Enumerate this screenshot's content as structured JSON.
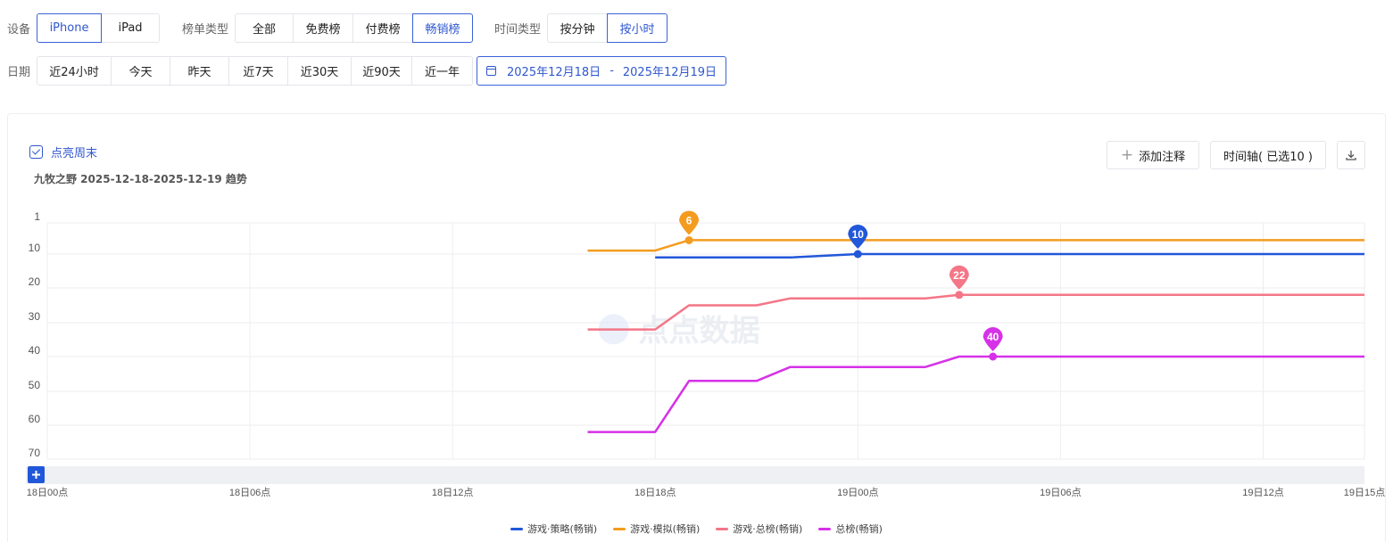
{
  "filters": {
    "device_label": "设备",
    "device_options": [
      "iPhone",
      "iPad"
    ],
    "device_selected": 0,
    "rank_type_label": "榜单类型",
    "rank_type_options": [
      "全部",
      "免费榜",
      "付费榜",
      "畅销榜"
    ],
    "rank_type_selected": 3,
    "time_type_label": "时间类型",
    "time_type_options": [
      "按分钟",
      "按小时"
    ],
    "time_type_selected": 1,
    "date_label": "日期",
    "date_options": [
      "近24小时",
      "今天",
      "昨天",
      "近7天",
      "近30天",
      "近90天",
      "近一年"
    ],
    "date_start": "2025年12月18日",
    "date_sep": "-",
    "date_end": "2025年12月19日"
  },
  "panel": {
    "weekend_label": "点亮周末",
    "weekend_checked": true,
    "subtitle": "九牧之野 2025-12-18-2025-12-19 趋势",
    "add_note_label": "添加注释",
    "timeline_label": "时间轴( 已选10 )",
    "download_icon": "download-icon",
    "zoom_icon": "plus-icon",
    "watermark": "点点数据"
  },
  "chart_data": {
    "type": "line",
    "title": "九牧之野 2025-12-18-2025-12-19 趋势",
    "y_inverted": true,
    "y_ticks": [
      1,
      10,
      20,
      30,
      40,
      50,
      60,
      70
    ],
    "ylim": [
      1,
      70
    ],
    "x_ticks": [
      "18日00点",
      "18日06点",
      "18日12点",
      "18日18点",
      "19日00点",
      "19日06点",
      "19日12点",
      "19日15点"
    ],
    "x_unit": "hours since 18日00点",
    "x_tick_hours": [
      0,
      6,
      12,
      18,
      24,
      30,
      36,
      39
    ],
    "grid": true,
    "legend_position": "bottom-center",
    "series": [
      {
        "name": "游戏·策略(畅销)",
        "color": "#2157d9",
        "points": [
          [
            18,
            11
          ],
          [
            20,
            11
          ],
          [
            22,
            11
          ],
          [
            24,
            10
          ],
          [
            26,
            10
          ],
          [
            28,
            10
          ],
          [
            39,
            10
          ]
        ],
        "marker": {
          "x": 24,
          "value": 10
        }
      },
      {
        "name": "游戏·模拟(畅销)",
        "color": "#f39c1f",
        "points": [
          [
            16,
            9
          ],
          [
            17,
            9
          ],
          [
            18,
            9
          ],
          [
            19,
            6
          ],
          [
            20,
            6
          ],
          [
            24,
            6
          ],
          [
            39,
            6
          ]
        ],
        "marker": {
          "x": 19,
          "value": 6
        }
      },
      {
        "name": "游戏·总榜(畅销)",
        "color": "#f47687",
        "points": [
          [
            16,
            32
          ],
          [
            17,
            32
          ],
          [
            18,
            32
          ],
          [
            19,
            25
          ],
          [
            20,
            25
          ],
          [
            21,
            25
          ],
          [
            22,
            23
          ],
          [
            25,
            23
          ],
          [
            26,
            23
          ],
          [
            27,
            22
          ],
          [
            39,
            22
          ]
        ],
        "marker": {
          "x": 27,
          "value": 22
        }
      },
      {
        "name": "总榜(畅销)",
        "color": "#d631e8",
        "points": [
          [
            16,
            62
          ],
          [
            17,
            62
          ],
          [
            18,
            62
          ],
          [
            19,
            47
          ],
          [
            20,
            47
          ],
          [
            21,
            47
          ],
          [
            22,
            43
          ],
          [
            25,
            43
          ],
          [
            26,
            43
          ],
          [
            27,
            40
          ],
          [
            28,
            40
          ],
          [
            39,
            40
          ]
        ],
        "marker": {
          "x": 28,
          "value": 40
        }
      }
    ]
  }
}
